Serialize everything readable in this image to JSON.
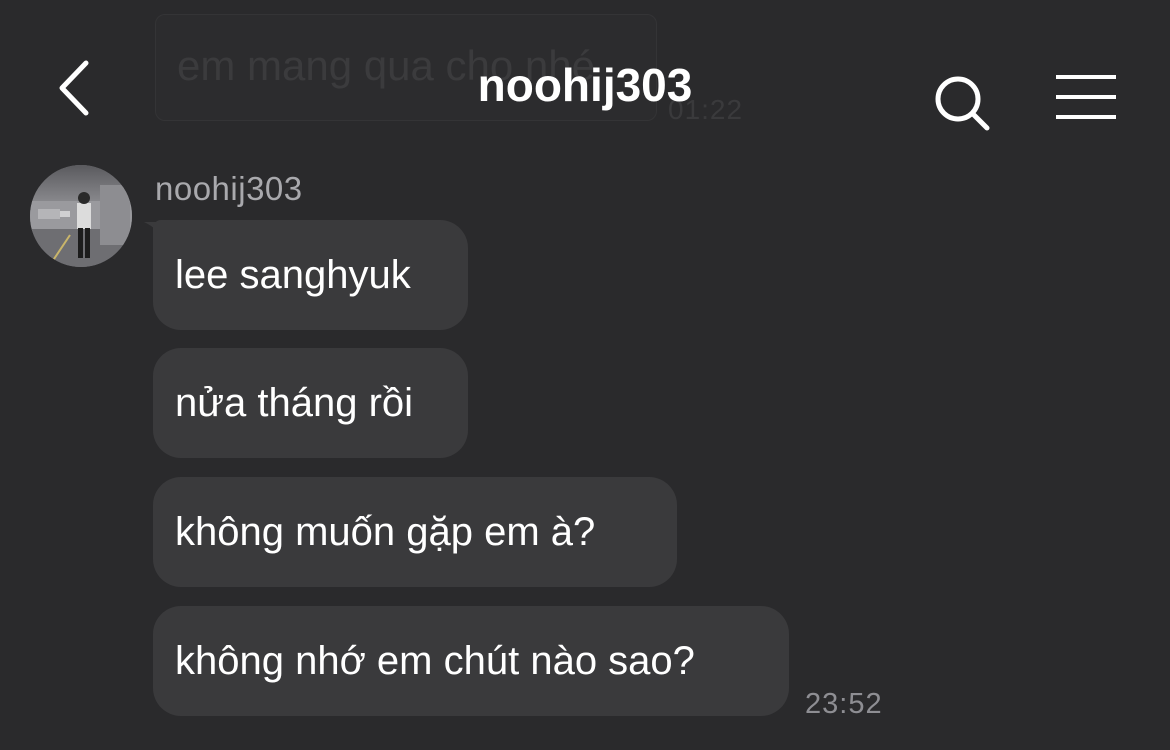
{
  "background_message": {
    "text": "em mang qua cho nhé",
    "time": "01:22"
  },
  "header": {
    "title": "noohij303",
    "back_icon": "chevron-left-icon",
    "search_icon": "search-icon",
    "menu_icon": "hamburger-menu-icon"
  },
  "conversation": {
    "sender": "noohij303",
    "messages": [
      {
        "text": "lee sanghyuk"
      },
      {
        "text": "nửa tháng rồi"
      },
      {
        "text": "không muốn gặp em à?"
      },
      {
        "text": "không nhớ em chút nào sao?"
      }
    ],
    "last_time": "23:52"
  },
  "colors": {
    "background": "#2a2a2c",
    "bubble": "#3a3a3c",
    "text_primary": "#ffffff",
    "text_secondary": "#a9a9ad",
    "timestamp": "#8e8e93"
  }
}
